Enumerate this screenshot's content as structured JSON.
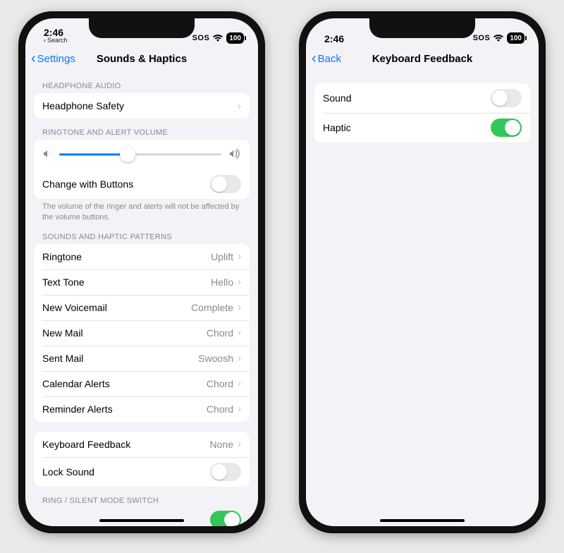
{
  "status": {
    "time": "2:46",
    "breadcrumb": "Search",
    "sos": "SOS",
    "battery": "100"
  },
  "left": {
    "nav_back": "Settings",
    "nav_title": "Sounds & Haptics",
    "headers": {
      "headphone": "HEADPHONE AUDIO",
      "volume": "RINGTONE AND ALERT VOLUME",
      "patterns": "SOUNDS AND HAPTIC PATTERNS",
      "ringsilent": "RING / SILENT MODE SWITCH"
    },
    "headphone_safety": "Headphone Safety",
    "change_with_buttons": {
      "label": "Change with Buttons",
      "on": false
    },
    "volume_footer": "The volume of the ringer and alerts will not be affected by the volume buttons.",
    "slider_percent": 42,
    "patterns": [
      {
        "label": "Ringtone",
        "value": "Uplift"
      },
      {
        "label": "Text Tone",
        "value": "Hello"
      },
      {
        "label": "New Voicemail",
        "value": "Complete"
      },
      {
        "label": "New Mail",
        "value": "Chord"
      },
      {
        "label": "Sent Mail",
        "value": "Swoosh"
      },
      {
        "label": "Calendar Alerts",
        "value": "Chord"
      },
      {
        "label": "Reminder Alerts",
        "value": "Chord"
      }
    ],
    "keyboard_feedback": {
      "label": "Keyboard Feedback",
      "value": "None"
    },
    "lock_sound": {
      "label": "Lock Sound",
      "on": false
    }
  },
  "right": {
    "nav_back": "Back",
    "nav_title": "Keyboard Feedback",
    "rows": {
      "sound": {
        "label": "Sound",
        "on": false
      },
      "haptic": {
        "label": "Haptic",
        "on": true
      }
    }
  }
}
